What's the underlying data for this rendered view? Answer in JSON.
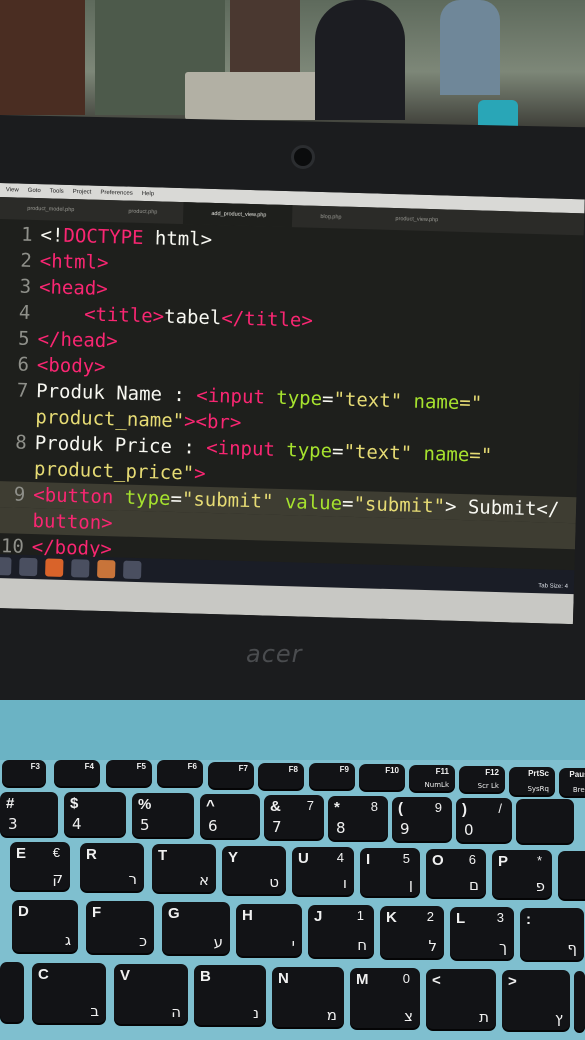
{
  "menu": [
    "View",
    "Goto",
    "Tools",
    "Project",
    "Preferences",
    "Help"
  ],
  "tabs": [
    {
      "label": "product_model.php",
      "active": false
    },
    {
      "label": "product.php",
      "active": false
    },
    {
      "label": "add_product_view.php",
      "active": true
    },
    {
      "label": "blog.php",
      "active": false
    },
    {
      "label": "product_view.php",
      "active": false
    }
  ],
  "code": {
    "l1_num": "1",
    "l1_a": "<!",
    "l1_b": "DOCTYPE",
    "l1_c": " html>",
    "l2_num": "2",
    "l2_a": "<html>",
    "l3_num": "3",
    "l3_a": "<head>",
    "l4_num": "4",
    "l4_a": "    <title>",
    "l4_b": "tabel",
    "l4_c": "</title>",
    "l5_num": "5",
    "l5_a": "</head>",
    "l6_num": "6",
    "l6_a": "<body>",
    "l7_num": "7",
    "l7_a": "Produk Name : ",
    "l7_b": "<input",
    "l7_c": " type",
    "l7_d": "=",
    "l7_e": "\"text\"",
    "l7_f": " name",
    "l7_g": "=\"",
    "l7w_a": "product_name\"",
    "l7w_b": "><br>",
    "l8_num": "8",
    "l8_a": "Produk Price : ",
    "l8_b": "<input",
    "l8_c": " type",
    "l8_d": "=",
    "l8_e": "\"text\"",
    "l8_f": " name",
    "l8_g": "=\"",
    "l8w_a": "product_price\"",
    "l8w_b": ">",
    "l9_num": "9",
    "l9_a": "<button",
    "l9_b": " type",
    "l9_c": "=",
    "l9_d": "\"submit\"",
    "l9_e": " value",
    "l9_f": "=",
    "l9_g": "\"submit\"",
    "l9_h": "> Submit</",
    "l9w_a": "button>",
    "l10_num": "10",
    "l10_a": "</body>"
  },
  "status": {
    "right": "Tab Size: 4"
  },
  "brand": "acer",
  "keys": {
    "f3": "F3",
    "f4": "F4",
    "f5": "F5",
    "f6": "F6",
    "f7": "F7",
    "f8": "F8",
    "f9": "F9",
    "f10": "F10",
    "f11": "F11",
    "f11b": "NumLk",
    "f12": "F12",
    "f12b": "Scr Lk",
    "prtsc": "PrtSc",
    "prtscb": "SysRq",
    "pause": "Pause",
    "pauseb": "Break",
    "n3": "3",
    "n3s": "#",
    "n4": "4",
    "n4s": "$",
    "n5": "5",
    "n5s": "%",
    "n6": "6",
    "n6s": "^",
    "n7": "7",
    "n7s": "&",
    "n7n": "7",
    "n8": "8",
    "n8s": "*",
    "n8n": "8",
    "n9": "9",
    "n9s": "(",
    "n9n": "9",
    "n0": "0",
    "n0s": ")",
    "n0n": "/",
    "e": "E",
    "eh": "ק",
    "eu": "€",
    "r": "R",
    "rh": "ר",
    "t": "T",
    "th": "א",
    "y": "Y",
    "yh": "ט",
    "u": "U",
    "un": "4",
    "uh": "ו",
    "i": "I",
    "in": "5",
    "ih": "ן",
    "o": "O",
    "on": "6",
    "oh": "ם",
    "p": "P",
    "pn": "*",
    "ph": "פ",
    "d": "D",
    "dh": "ג",
    "f": "F",
    "fh": "כ",
    "g": "G",
    "gh": "ע",
    "h": "H",
    "hh": "י",
    "j": "J",
    "jn": "1",
    "jh": "ח",
    "k": "K",
    "kn": "2",
    "kh": "ל",
    "l": "L",
    "ln": "3",
    "lh": "ך",
    "semi": ":",
    "semih": "ף",
    "c": "C",
    "ch": "ב",
    "v": "V",
    "vh": "ה",
    "b": "B",
    "bh": "נ",
    "n": "N",
    "nh": "מ",
    "m": "M",
    "mn": "0",
    "mh": "צ",
    "comma": "<",
    "commah": "ת",
    "period": ">",
    "periodh": "ץ",
    "slash": "?"
  }
}
